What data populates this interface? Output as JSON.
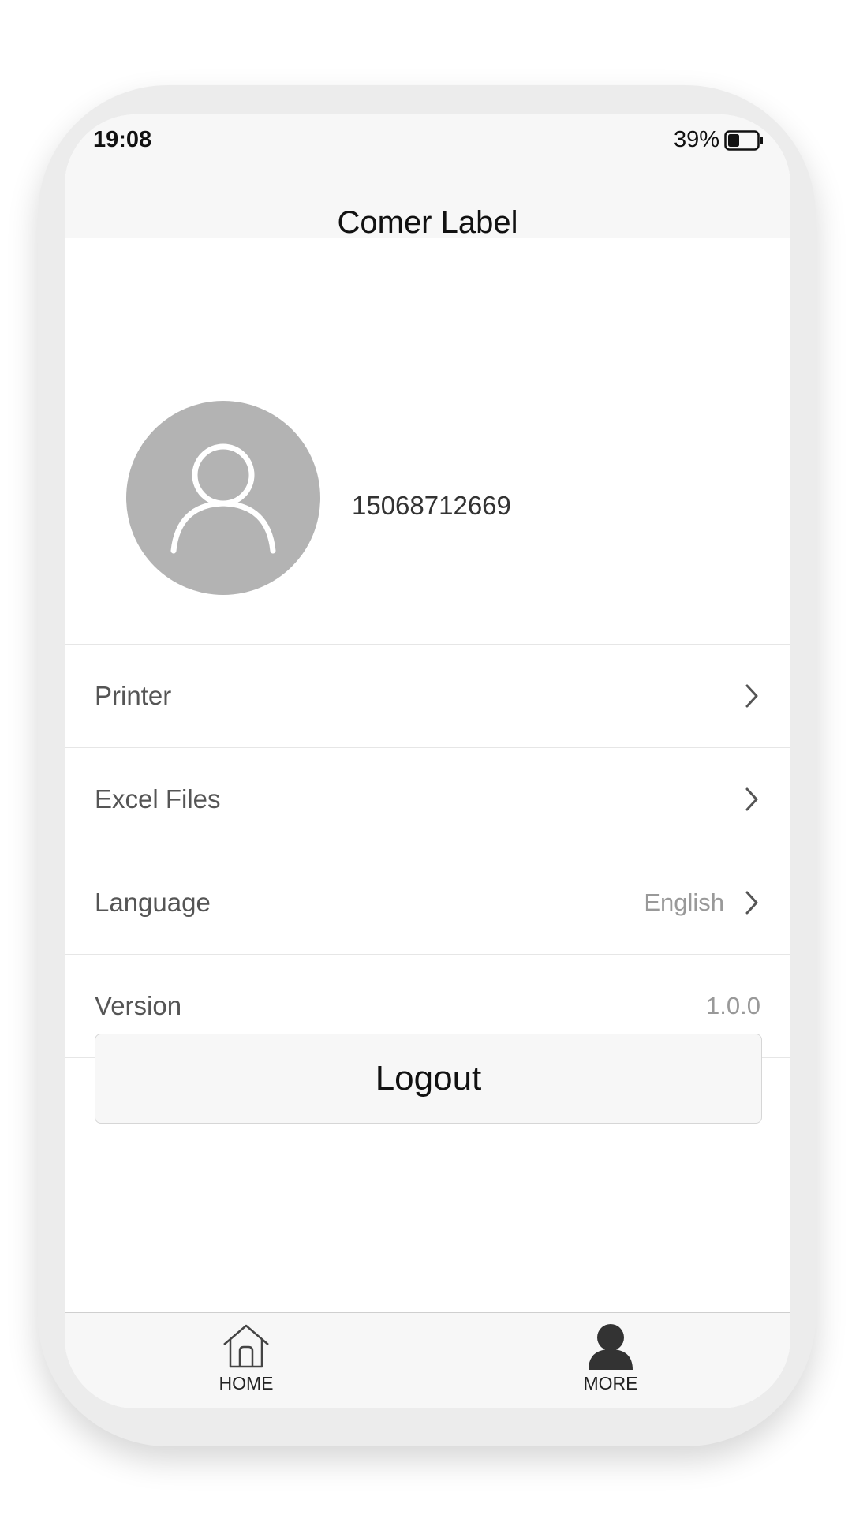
{
  "status_bar": {
    "time": "19:08",
    "battery_percent": "39%",
    "battery_level": 0.39
  },
  "nav": {
    "title": "Comer Label"
  },
  "profile": {
    "avatar_icon": "user-icon",
    "phone": "15068712669"
  },
  "menu": {
    "printer": {
      "label": "Printer",
      "icon": "chevron-right-icon"
    },
    "excel_files": {
      "label": "Excel Files",
      "icon": "chevron-right-icon"
    },
    "language": {
      "label": "Language",
      "value": "English",
      "icon": "chevron-right-icon"
    },
    "version": {
      "label": "Version",
      "value": "1.0.0"
    }
  },
  "logout": {
    "label": "Logout"
  },
  "tab_bar": {
    "home": {
      "label": "HOME",
      "icon": "home-icon"
    },
    "more": {
      "label": "MORE",
      "icon": "person-icon"
    }
  },
  "colors": {
    "background": "#ffffff",
    "bar_background": "#f7f7f7",
    "avatar": "#b3b3b3",
    "divider": "#e6e6e6",
    "text_primary": "#111111",
    "text_secondary": "#555555",
    "text_muted": "#999999"
  }
}
